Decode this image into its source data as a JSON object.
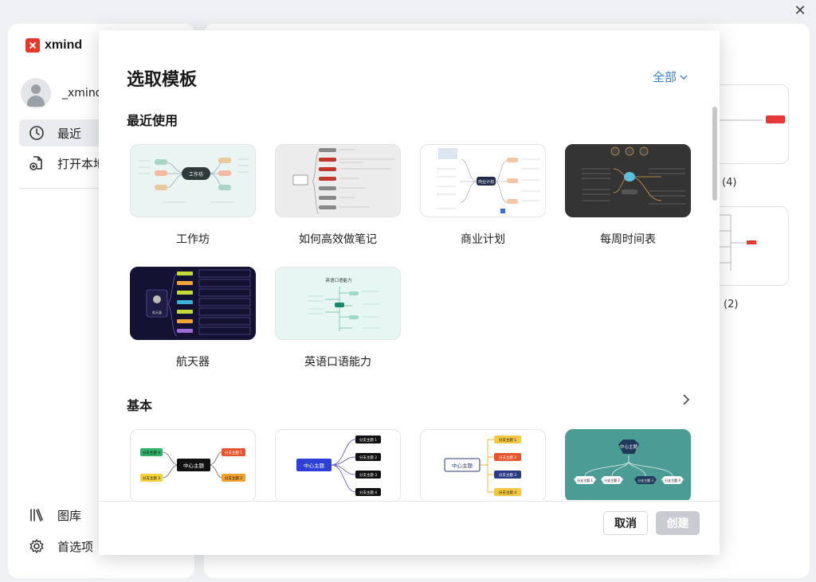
{
  "app": {
    "name": "xmind"
  },
  "user": {
    "name": "_xmind_"
  },
  "sidebar": {
    "items": [
      {
        "label": "最近",
        "icon": "clock-icon"
      },
      {
        "label": "打开本地",
        "icon": "open-file-icon"
      },
      {
        "label": "图库",
        "icon": "library-icon"
      },
      {
        "label": "首选项",
        "icon": "gear-icon"
      }
    ]
  },
  "background": {
    "counts": [
      "(4)",
      "(2)"
    ]
  },
  "modal": {
    "title": "选取模板",
    "filter_label": "全部",
    "sections": [
      {
        "title": "最近使用",
        "templates": [
          {
            "label": "工作坊",
            "center": "工作坊"
          },
          {
            "label": "如何高效做笔记"
          },
          {
            "label": "商业计划",
            "center": "商业计划"
          },
          {
            "label": "每周时间表"
          },
          {
            "label": "航天器",
            "center": "航天器"
          },
          {
            "label": "英语口语能力",
            "center": "英语口语能力"
          }
        ]
      },
      {
        "title": "基本",
        "templates": [
          {
            "center": "中心主题",
            "topics": [
              "分支主题 4",
              "分支主题 1",
              "分支主题 3",
              "分支主题 2"
            ]
          },
          {
            "center": "中心主题",
            "topics": [
              "分支主题 1",
              "分支主题 2",
              "分支主题 3",
              "分支主题 4"
            ]
          },
          {
            "center": "中心主题",
            "topics": [
              "分支主题 1",
              "分支主题 2",
              "分支主题 3",
              "分支主题 4"
            ]
          },
          {
            "center": "中心主题",
            "topics": [
              "分支主题 1",
              "分支主题 2",
              "分支主题 3",
              "分支主题 4"
            ]
          }
        ]
      }
    ],
    "cancel_label": "取消",
    "create_label": "创建"
  },
  "colors": {
    "accent": "#3b82c4",
    "brand": "#e8382c"
  }
}
